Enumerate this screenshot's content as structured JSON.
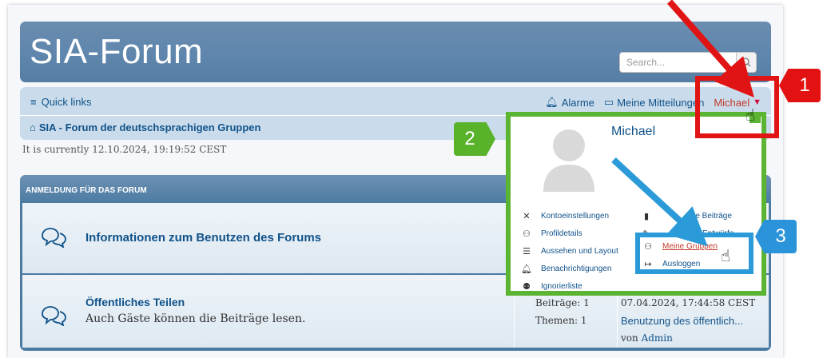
{
  "header": {
    "site_title": "SIA-Forum",
    "search_placeholder": "Search..."
  },
  "navbar": {
    "quick_links": "Quick links",
    "alarms": "Alarme",
    "messages": "Meine Mitteilungen",
    "user": "Michael",
    "breadcrumb": "SIA - Forum der deutschsprachigen Gruppen"
  },
  "time": "It is currently  12.10.2024, 19:19:52 CEST",
  "forum": {
    "heading": "ANMELDUNG FÜR DAS FORUM",
    "rows": [
      {
        "title": "Informationen zum Benutzen des Forums"
      },
      {
        "title": "Öffentliches Teilen",
        "desc": "Auch Gäste können die Beiträge lesen.",
        "posts": "Beiträge: 1",
        "topics": "Themen: 1",
        "last_time": "07.04.2024, 17:44:58 CEST",
        "last_topic": "Benutzung des öffentlich...",
        "last_by": "von",
        "last_author": "Admin"
      }
    ]
  },
  "dropdown": {
    "username": "Michael",
    "left_menu": [
      {
        "label": "Kontoeinstellungen",
        "icon": "wrench-icon"
      },
      {
        "label": "Profildetails",
        "icon": "users-icon"
      },
      {
        "label": "Aussehen und Layout",
        "icon": "sliders-icon"
      },
      {
        "label": "Benachrichtigungen",
        "icon": "bell-icon"
      },
      {
        "label": "Ignorierliste",
        "icon": "user-block-icon"
      }
    ],
    "right_menu": [
      {
        "label": "eine Beiträge",
        "icon": "file-icon"
      },
      {
        "label": "Entwürfe",
        "icon": "pen-icon"
      },
      {
        "label": "Meine Gruppen",
        "icon": "group-icon"
      },
      {
        "label": "Ausloggen",
        "icon": "logout-icon"
      }
    ]
  },
  "annotations": {
    "badge1": "1",
    "badge2": "2",
    "badge3": "3",
    "colors": {
      "red": "#e31212",
      "green": "#58b32b",
      "blue": "#2b93d9"
    }
  }
}
